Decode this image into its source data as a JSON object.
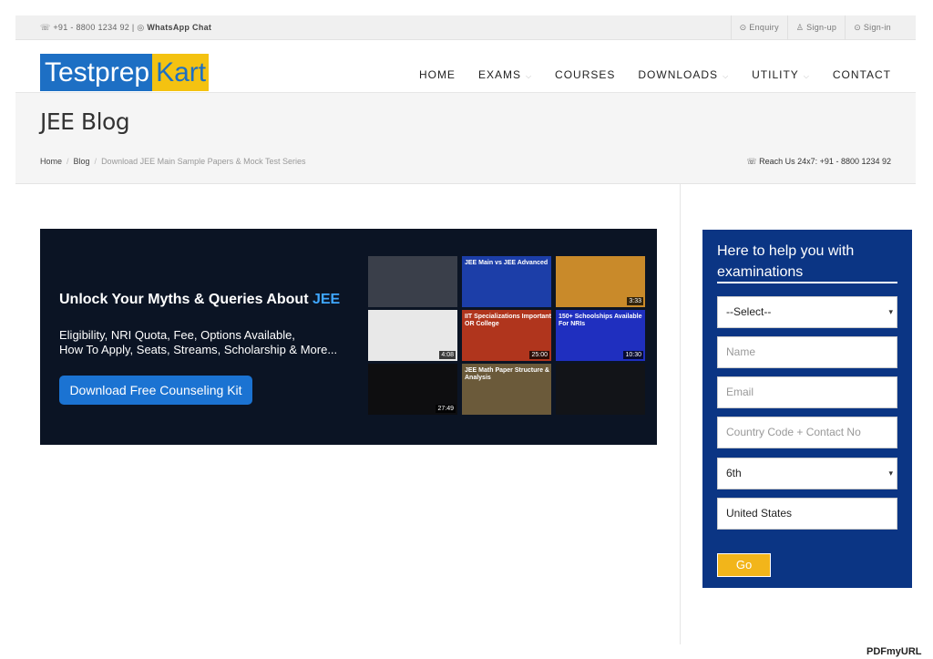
{
  "topbar": {
    "phone": "+91 - 8800 1234 92",
    "whatsapp": "WhatsApp Chat",
    "links": [
      "Enquiry",
      "Sign-up",
      "Sign-in"
    ]
  },
  "header": {
    "logo_part1": "Testprep",
    "logo_part2": "Kart",
    "nav": [
      {
        "label": "HOME",
        "has_dropdown": false
      },
      {
        "label": "EXAMS",
        "has_dropdown": true
      },
      {
        "label": "COURSES",
        "has_dropdown": false
      },
      {
        "label": "DOWNLOADS",
        "has_dropdown": true
      },
      {
        "label": "UTILITY",
        "has_dropdown": true
      },
      {
        "label": "CONTACT",
        "has_dropdown": false
      }
    ]
  },
  "page": {
    "title": "JEE Blog",
    "breadcrumb": [
      "Home",
      "Blog",
      "Download JEE Main Sample Papers & Mock Test Series"
    ],
    "reach": "Reach Us 24x7: +91 - 8800 1234 92"
  },
  "banner": {
    "headline": "Unlock Your Myths & Queries About",
    "headline_highlight": "JEE",
    "line1": "Eligibility, NRI Quota, Fee, Options Available,",
    "line2": "How To Apply, Seats, Streams, Scholarship & More...",
    "cta": "Download Free Counseling Kit",
    "thumbs": [
      {
        "caption": "",
        "duration": "",
        "color": "#3a3f4a"
      },
      {
        "caption": "JEE Main vs JEE Advanced",
        "duration": "",
        "color": "#1c3ea8"
      },
      {
        "caption": "",
        "duration": "3:33",
        "color": "#c98a2a"
      },
      {
        "caption": "",
        "duration": "4:08",
        "color": "#e8e8e8"
      },
      {
        "caption": "IIT Specializations Important OR College",
        "duration": "25:00",
        "color": "#b0351d"
      },
      {
        "caption": "150+ Schoolships Available For NRIs",
        "duration": "10:30",
        "color": "#1f2fbf"
      },
      {
        "caption": "",
        "duration": "27:49",
        "color": "#0e0e10"
      },
      {
        "caption": "JEE Math Paper Structure & Analysis",
        "duration": "",
        "color": "#6b5a3a"
      },
      {
        "caption": "",
        "duration": "",
        "color": "#121418"
      }
    ]
  },
  "form": {
    "title": "Here to help you with examinations",
    "select_default": "--Select--",
    "name_placeholder": "Name",
    "email_placeholder": "Email",
    "contact_placeholder": "Country Code + Contact No",
    "grade_value": "6th",
    "country_value": "United States",
    "submit": "Go"
  },
  "watermark": "PDFmyURL"
}
